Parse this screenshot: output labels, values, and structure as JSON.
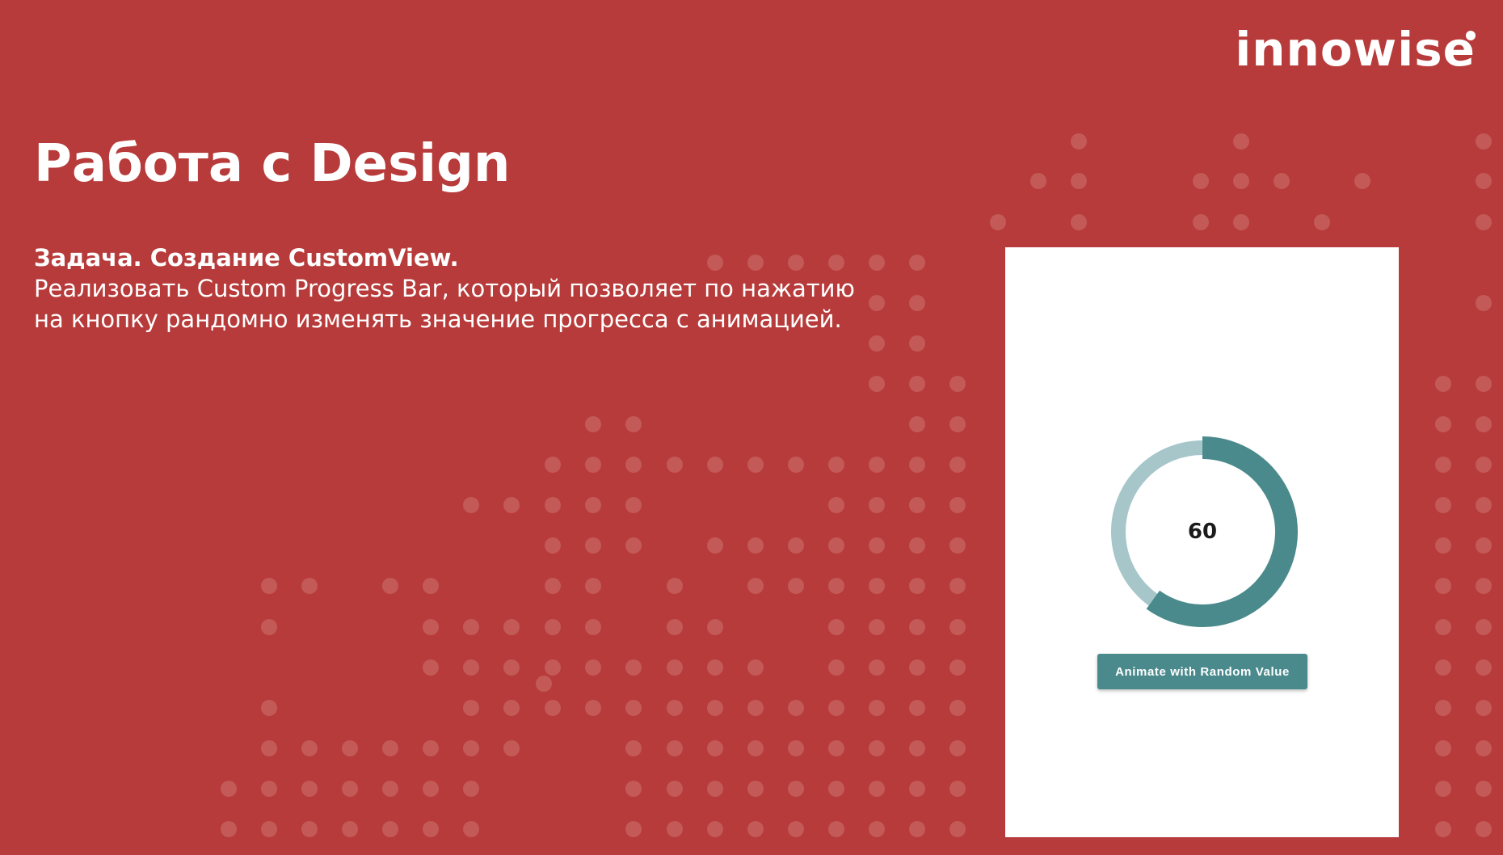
{
  "brand": {
    "logo_text": "innowise",
    "background_color": "#b73b3a",
    "dot_color": "#c35a58"
  },
  "slide": {
    "title": "Работа с Design",
    "task_heading": "Задача. Создание CustomView.",
    "task_body": "Реализовать Custom Progress Bar, который позволяет по нажатию\nна кнопку рандомно изменять значение прогресса с анимацией."
  },
  "phone_mockup": {
    "progress": {
      "value": 60,
      "max": 100,
      "value_label": "60",
      "progress_color": "#4a8a8c",
      "track_color": "#a6c6ca"
    },
    "button": {
      "label": "Animate with Random Value",
      "color": "#4a8a8c"
    }
  }
}
